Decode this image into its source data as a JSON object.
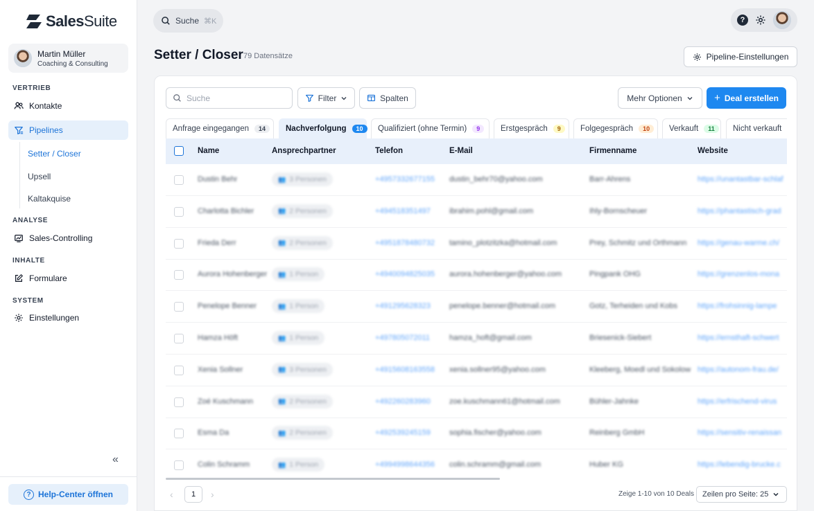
{
  "app": {
    "logo_bold": "Sales",
    "logo_light": "Suite"
  },
  "user": {
    "name": "Martin Müller",
    "company": "Coaching & Consulting"
  },
  "sidebar": {
    "sections": {
      "vertrieb": "VERTRIEB",
      "analyse": "ANALYSE",
      "inhalte": "INHALTE",
      "system": "SYSTEM"
    },
    "items": {
      "kontakte": "Kontakte",
      "pipelines": "Pipelines",
      "setter": "Setter / Closer",
      "upsell": "Upsell",
      "kaltakquise": "Kaltakquise",
      "sales_controlling": "Sales-Controlling",
      "formulare": "Formulare",
      "einstellungen": "Einstellungen"
    },
    "collapse_icon": "«",
    "help_label": "Help-Center öffnen"
  },
  "topbar": {
    "search_label": "Suche",
    "search_shortcut": "⌘K"
  },
  "page": {
    "title": "Setter / Closer",
    "count": "79 Datensätze",
    "pipeline_settings": "Pipeline-Einstellungen"
  },
  "toolbar": {
    "search_placeholder": "Suche",
    "filter": "Filter",
    "columns": "Spalten",
    "more_options": "Mehr Optionen",
    "create_deal": "Deal erstellen"
  },
  "tabs": [
    {
      "label": "Anfrage eingegangen",
      "count": "14",
      "badge_bg": "#eceef1",
      "badge_fg": "#374151"
    },
    {
      "label": "Nachverfolgung",
      "count": "10",
      "badge_bg": "#1e88f0",
      "badge_fg": "#ffffff"
    },
    {
      "label": "Qualifiziert (ohne Termin)",
      "count": "9",
      "badge_bg": "#f3e8ff",
      "badge_fg": "#9333ea"
    },
    {
      "label": "Erstgespräch",
      "count": "9",
      "badge_bg": "#fef9c3",
      "badge_fg": "#a16207"
    },
    {
      "label": "Folgegespräch",
      "count": "10",
      "badge_bg": "#ffedd5",
      "badge_fg": "#c2410c"
    },
    {
      "label": "Verkauft",
      "count": "11",
      "badge_bg": "#dcfce7",
      "badge_fg": "#15803d"
    },
    {
      "label": "Nicht verkauft",
      "count": "",
      "badge_bg": "",
      "badge_fg": ""
    }
  ],
  "table": {
    "columns": [
      "Name",
      "Ansprechpartner",
      "Telefon",
      "E-Mail",
      "Firmenname",
      "Website"
    ],
    "rows": [
      {
        "name": "Dustin Behr",
        "contact": "3 Personen",
        "phone": "+4957332677155",
        "email": "dustin_behr70@yahoo.com",
        "company": "Barr-Ahrens",
        "website": "https://unantastbar-schlaf"
      },
      {
        "name": "Charlotta Bichler",
        "contact": "2 Personen",
        "phone": "+494518351497",
        "email": "ibrahim.pohl@gmail.com",
        "company": "Ihly-Bornscheuer",
        "website": "https://phantastisch-grad"
      },
      {
        "name": "Frieda Derr",
        "contact": "2 Personen",
        "phone": "+4951878480732",
        "email": "tamino_plotzitzka@hotmail.com",
        "company": "Prey, Schmitz und Orthmann",
        "website": "https://genau-warme.ch/"
      },
      {
        "name": "Aurora Hohenberger",
        "contact": "1 Person",
        "phone": "+4940094825035",
        "email": "aurora.hohenberger@yahoo.com",
        "company": "Pingpank OHG",
        "website": "https://grenzenlos-mona"
      },
      {
        "name": "Penelope Benner",
        "contact": "1 Person",
        "phone": "+491295628323",
        "email": "penelope.benner@hotmail.com",
        "company": "Gotz, Terheiden und Kobs",
        "website": "https://frohsinnig-lampe"
      },
      {
        "name": "Hamza Höft",
        "contact": "1 Person",
        "phone": "+497805072011",
        "email": "hamza_hoft@gmail.com",
        "company": "Briesenick-Siebert",
        "website": "https://ernsthaft-schwert"
      },
      {
        "name": "Xenia Sollner",
        "contact": "3 Personen",
        "phone": "+4915608163558",
        "email": "xenia.sollner95@yahoo.com",
        "company": "Kleeberg, Moedl und Sokolow",
        "website": "https://autonom-frau.de/"
      },
      {
        "name": "Zoé Kuschmann",
        "contact": "2 Personen",
        "phone": "+492260283960",
        "email": "zoe.kuschmann61@hotmail.com",
        "company": "Bühler-Jahnke",
        "website": "https://erfrischend-virus"
      },
      {
        "name": "Esma Da",
        "contact": "2 Personen",
        "phone": "+492539245159",
        "email": "sophia.fischer@yahoo.com",
        "company": "Reinberg GmbH",
        "website": "https://sensitiv-renaissan"
      },
      {
        "name": "Colin Schramm",
        "contact": "1 Person",
        "phone": "+4994998644356",
        "email": "colin.schramm@gmail.com",
        "company": "Huber KG",
        "website": "https://lebendig-brucke.c"
      }
    ]
  },
  "pagination": {
    "prev": "‹",
    "page": "1",
    "next": "›",
    "info": "Zeige 1-10 von 10 Deals",
    "per_page": "Zeilen pro Seite: 25"
  },
  "colors": {
    "accent": "#1e88f0",
    "active_bg": "#e6f0fb"
  }
}
